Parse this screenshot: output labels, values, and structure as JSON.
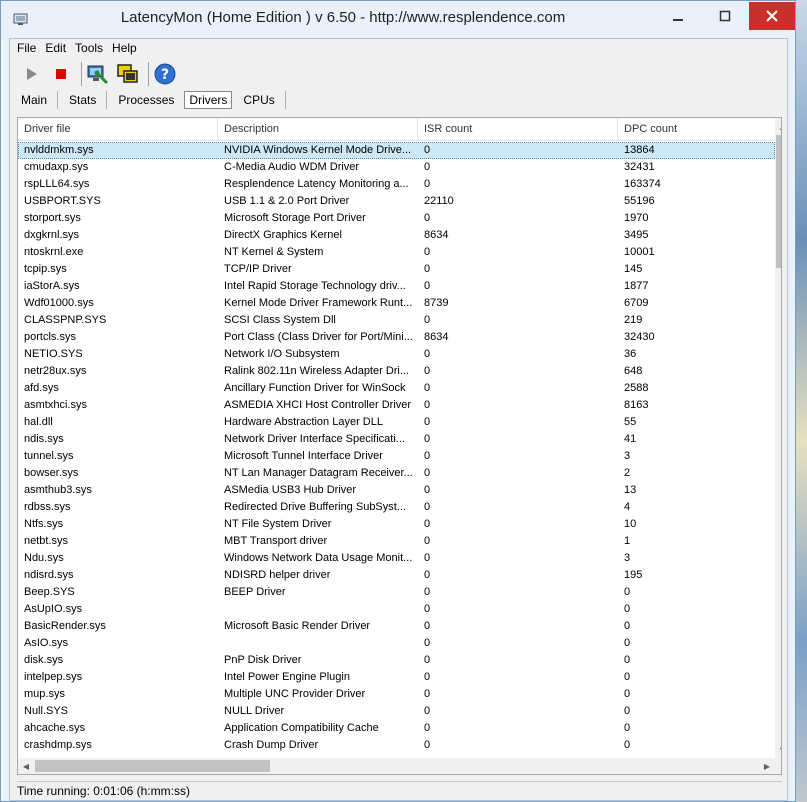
{
  "window": {
    "title": "LatencyMon  (Home Edition )  v 6.50 - http://www.resplendence.com"
  },
  "menu": [
    "File",
    "Edit",
    "Tools",
    "Help"
  ],
  "toolbar": {
    "icons": [
      "play-icon",
      "stop-icon",
      "computer-wrench-icon",
      "windows-icon",
      "help-icon"
    ]
  },
  "tabs": [
    {
      "label": "Main"
    },
    {
      "label": "Stats"
    },
    {
      "label": "Processes"
    },
    {
      "label": "Drivers",
      "active": true
    },
    {
      "label": "CPUs"
    }
  ],
  "table": {
    "columns": [
      "Driver file",
      "Description",
      "ISR count",
      "DPC count"
    ],
    "rows": [
      [
        "nvlddmkm.sys",
        "NVIDIA Windows Kernel Mode Drive...",
        "0",
        "13864"
      ],
      [
        "cmudaxp.sys",
        "C-Media Audio WDM Driver",
        "0",
        "32431"
      ],
      [
        "rspLLL64.sys",
        "Resplendence Latency Monitoring a...",
        "0",
        "163374"
      ],
      [
        "USBPORT.SYS",
        "USB 1.1 & 2.0 Port Driver",
        "22110",
        "55196"
      ],
      [
        "storport.sys",
        "Microsoft Storage Port Driver",
        "0",
        "1970"
      ],
      [
        "dxgkrnl.sys",
        "DirectX Graphics Kernel",
        "8634",
        "3495"
      ],
      [
        "ntoskrnl.exe",
        "NT Kernel & System",
        "0",
        "10001"
      ],
      [
        "tcpip.sys",
        "TCP/IP Driver",
        "0",
        "145"
      ],
      [
        "iaStorA.sys",
        "Intel Rapid Storage Technology driv...",
        "0",
        "1877"
      ],
      [
        "Wdf01000.sys",
        "Kernel Mode Driver Framework Runt...",
        "8739",
        "6709"
      ],
      [
        "CLASSPNP.SYS",
        "SCSI Class System Dll",
        "0",
        "219"
      ],
      [
        "portcls.sys",
        "Port Class (Class Driver for Port/Mini...",
        "8634",
        "32430"
      ],
      [
        "NETIO.SYS",
        "Network I/O Subsystem",
        "0",
        "36"
      ],
      [
        "netr28ux.sys",
        "Ralink 802.11n Wireless Adapter Dri...",
        "0",
        "648"
      ],
      [
        "afd.sys",
        "Ancillary Function Driver for WinSock",
        "0",
        "2588"
      ],
      [
        "asmtxhci.sys",
        "ASMEDIA XHCI Host Controller Driver",
        "0",
        "8163"
      ],
      [
        "hal.dll",
        "Hardware Abstraction Layer DLL",
        "0",
        "55"
      ],
      [
        "ndis.sys",
        "Network Driver Interface Specificati...",
        "0",
        "41"
      ],
      [
        "tunnel.sys",
        "Microsoft Tunnel Interface Driver",
        "0",
        "3"
      ],
      [
        "bowser.sys",
        "NT Lan Manager Datagram Receiver...",
        "0",
        "2"
      ],
      [
        "asmthub3.sys",
        "ASMedia USB3 Hub Driver",
        "0",
        "13"
      ],
      [
        "rdbss.sys",
        "Redirected Drive Buffering SubSyst...",
        "0",
        "4"
      ],
      [
        "Ntfs.sys",
        "NT File System Driver",
        "0",
        "10"
      ],
      [
        "netbt.sys",
        "MBT Transport driver",
        "0",
        "1"
      ],
      [
        "Ndu.sys",
        "Windows Network Data Usage Monit...",
        "0",
        "3"
      ],
      [
        "ndisrd.sys",
        "NDISRD helper driver",
        "0",
        "195"
      ],
      [
        "Beep.SYS",
        "BEEP Driver",
        "0",
        "0"
      ],
      [
        "AsUpIO.sys",
        "",
        "0",
        "0"
      ],
      [
        "BasicRender.sys",
        "Microsoft Basic Render Driver",
        "0",
        "0"
      ],
      [
        "AsIO.sys",
        "",
        "0",
        "0"
      ],
      [
        "disk.sys",
        "PnP Disk Driver",
        "0",
        "0"
      ],
      [
        "intelpep.sys",
        "Intel Power Engine Plugin",
        "0",
        "0"
      ],
      [
        "mup.sys",
        "Multiple UNC Provider Driver",
        "0",
        "0"
      ],
      [
        "Null.SYS",
        "NULL Driver",
        "0",
        "0"
      ],
      [
        "ahcache.sys",
        "Application Compatibility Cache",
        "0",
        "0"
      ],
      [
        "crashdmp.sys",
        "Crash Dump Driver",
        "0",
        "0"
      ]
    ],
    "selected_row": 0
  },
  "status": {
    "text": "Time running: 0:01:06  (h:mm:ss)"
  },
  "colors": {
    "selection": "#cde8f7",
    "close_button": "#c9302c",
    "stop": "#e00000"
  }
}
